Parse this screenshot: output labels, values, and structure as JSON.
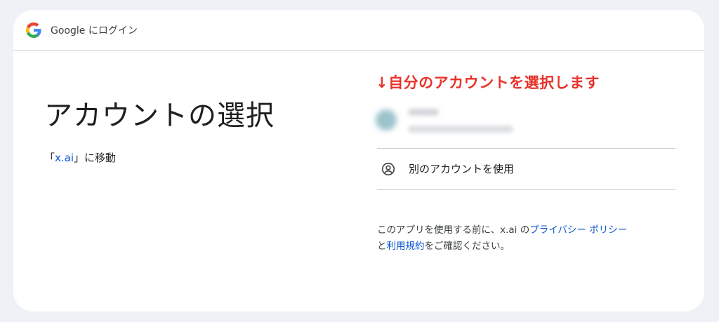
{
  "header": {
    "title": "Google にログイン",
    "logo_icon": "google-g-icon"
  },
  "main": {
    "title": "アカウントの選択",
    "subtitle_open": "「",
    "subtitle_link": "x.ai",
    "subtitle_close": "」に移動"
  },
  "annotation": {
    "text": "↓自分のアカウントを選択します",
    "color": "#e8332b"
  },
  "accounts": {
    "use_other_label": "別のアカウントを使用",
    "use_other_icon": "account-circle-icon"
  },
  "privacy": {
    "prefix": "このアプリを使用する前に、x.ai の",
    "privacy_link": "プライバシー ポリシー",
    "middle": "と",
    "terms_link": "利用規約",
    "suffix": "をご確認ください。"
  },
  "colors": {
    "link": "#0b57d0",
    "background": "#eef1f6",
    "card": "#ffffff"
  }
}
